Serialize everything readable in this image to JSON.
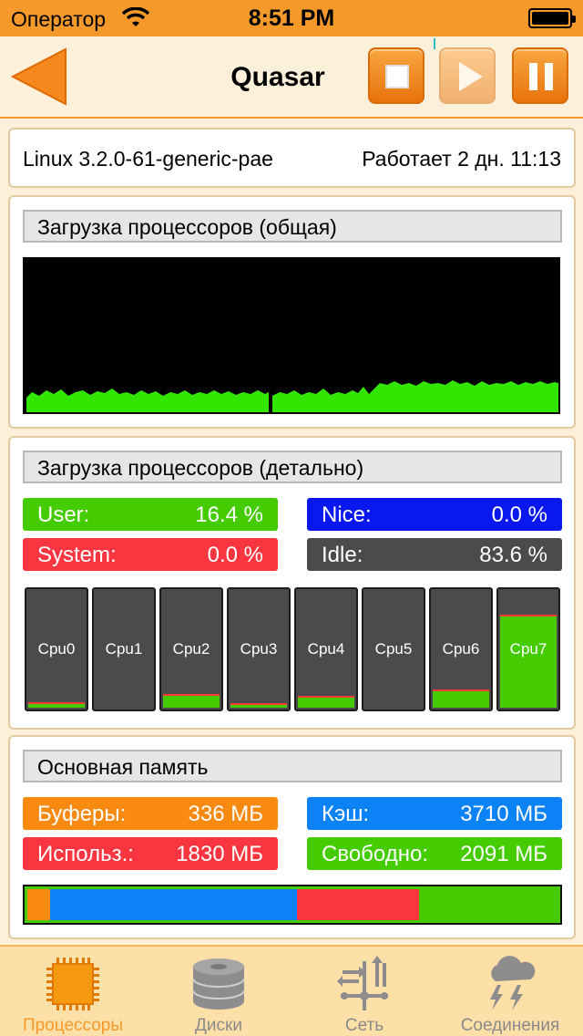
{
  "status_bar": {
    "carrier": "Оператор",
    "time": "8:51 PM"
  },
  "nav": {
    "title": "Quasar",
    "back_icon": "back-arrow-icon",
    "buttons": [
      "stop-icon",
      "play-icon",
      "pause-icon"
    ]
  },
  "info": {
    "os": "Linux 3.2.0-61-generic-pae",
    "uptime": "Работает 2 дн. 11:13"
  },
  "cpu_total": {
    "header": "Загрузка процессоров (общая)",
    "graph_color": "#33e600"
  },
  "cpu_detail": {
    "header": "Загрузка процессоров (детально)",
    "stats": [
      {
        "label": "User:",
        "value": "16.4 %",
        "color": "#44cc00"
      },
      {
        "label": "Nice:",
        "value": "0.0 %",
        "color": "#0a18f0"
      },
      {
        "label": "System:",
        "value": "0.0 %",
        "color": "#f93540"
      },
      {
        "label": "Idle:",
        "value": "83.6 %",
        "color": "#4b4b4b"
      }
    ],
    "cpus": [
      {
        "name": "Cpu0",
        "load": 0.05
      },
      {
        "name": "Cpu1",
        "load": 0.0
      },
      {
        "name": "Cpu2",
        "load": 0.12
      },
      {
        "name": "Cpu3",
        "load": 0.04
      },
      {
        "name": "Cpu4",
        "load": 0.1
      },
      {
        "name": "Cpu5",
        "load": 0.01
      },
      {
        "name": "Cpu6",
        "load": 0.16
      },
      {
        "name": "Cpu7",
        "load": 0.8
      }
    ]
  },
  "memory": {
    "header": "Основная память",
    "stats": [
      {
        "label": "Буферы:",
        "value": "336 МБ",
        "color": "#f88a10"
      },
      {
        "label": "Кэш:",
        "value": "3710 МБ",
        "color": "#0c82f7"
      },
      {
        "label": "Использ.:",
        "value": "1830 МБ",
        "color": "#f93540"
      },
      {
        "label": "Свободно:",
        "value": "2091 МБ",
        "color": "#44cc00"
      }
    ],
    "bar_mb": {
      "buffers": 336,
      "cache": 3710,
      "used": 1830,
      "free": 2091
    }
  },
  "tabs": [
    {
      "label": "Процессоры",
      "icon": "cpu-chip-icon",
      "active": true
    },
    {
      "label": "Диски",
      "icon": "disk-icon",
      "active": false
    },
    {
      "label": "Сеть",
      "icon": "network-icon",
      "active": false
    },
    {
      "label": "Соединения",
      "icon": "connections-cloud-icon",
      "active": false
    }
  ]
}
